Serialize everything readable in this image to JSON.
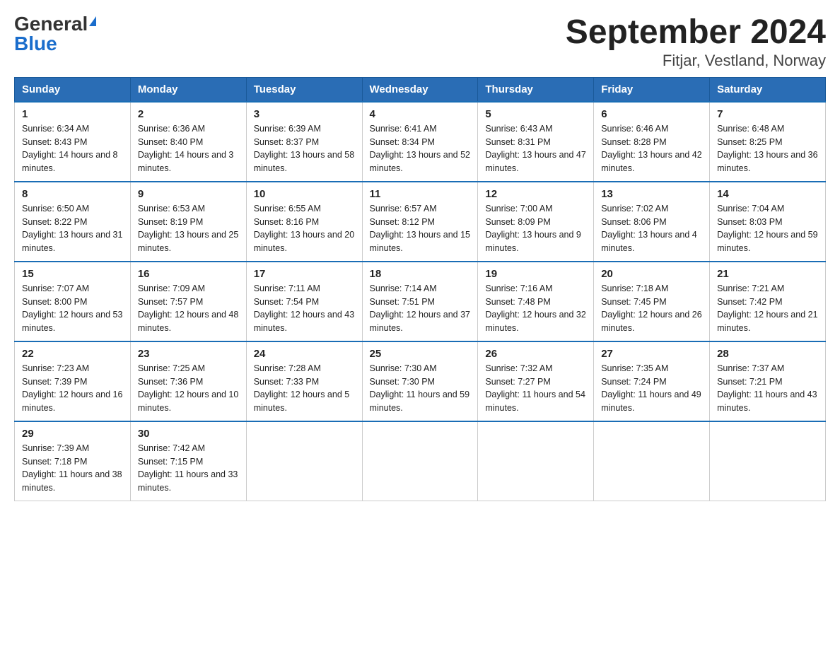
{
  "logo": {
    "general": "General",
    "blue": "Blue"
  },
  "title": "September 2024",
  "subtitle": "Fitjar, Vestland, Norway",
  "weekdays": [
    "Sunday",
    "Monday",
    "Tuesday",
    "Wednesday",
    "Thursday",
    "Friday",
    "Saturday"
  ],
  "weeks": [
    [
      {
        "day": "1",
        "sunrise": "6:34 AM",
        "sunset": "8:43 PM",
        "daylight": "14 hours and 8 minutes."
      },
      {
        "day": "2",
        "sunrise": "6:36 AM",
        "sunset": "8:40 PM",
        "daylight": "14 hours and 3 minutes."
      },
      {
        "day": "3",
        "sunrise": "6:39 AM",
        "sunset": "8:37 PM",
        "daylight": "13 hours and 58 minutes."
      },
      {
        "day": "4",
        "sunrise": "6:41 AM",
        "sunset": "8:34 PM",
        "daylight": "13 hours and 52 minutes."
      },
      {
        "day": "5",
        "sunrise": "6:43 AM",
        "sunset": "8:31 PM",
        "daylight": "13 hours and 47 minutes."
      },
      {
        "day": "6",
        "sunrise": "6:46 AM",
        "sunset": "8:28 PM",
        "daylight": "13 hours and 42 minutes."
      },
      {
        "day": "7",
        "sunrise": "6:48 AM",
        "sunset": "8:25 PM",
        "daylight": "13 hours and 36 minutes."
      }
    ],
    [
      {
        "day": "8",
        "sunrise": "6:50 AM",
        "sunset": "8:22 PM",
        "daylight": "13 hours and 31 minutes."
      },
      {
        "day": "9",
        "sunrise": "6:53 AM",
        "sunset": "8:19 PM",
        "daylight": "13 hours and 25 minutes."
      },
      {
        "day": "10",
        "sunrise": "6:55 AM",
        "sunset": "8:16 PM",
        "daylight": "13 hours and 20 minutes."
      },
      {
        "day": "11",
        "sunrise": "6:57 AM",
        "sunset": "8:12 PM",
        "daylight": "13 hours and 15 minutes."
      },
      {
        "day": "12",
        "sunrise": "7:00 AM",
        "sunset": "8:09 PM",
        "daylight": "13 hours and 9 minutes."
      },
      {
        "day": "13",
        "sunrise": "7:02 AM",
        "sunset": "8:06 PM",
        "daylight": "13 hours and 4 minutes."
      },
      {
        "day": "14",
        "sunrise": "7:04 AM",
        "sunset": "8:03 PM",
        "daylight": "12 hours and 59 minutes."
      }
    ],
    [
      {
        "day": "15",
        "sunrise": "7:07 AM",
        "sunset": "8:00 PM",
        "daylight": "12 hours and 53 minutes."
      },
      {
        "day": "16",
        "sunrise": "7:09 AM",
        "sunset": "7:57 PM",
        "daylight": "12 hours and 48 minutes."
      },
      {
        "day": "17",
        "sunrise": "7:11 AM",
        "sunset": "7:54 PM",
        "daylight": "12 hours and 43 minutes."
      },
      {
        "day": "18",
        "sunrise": "7:14 AM",
        "sunset": "7:51 PM",
        "daylight": "12 hours and 37 minutes."
      },
      {
        "day": "19",
        "sunrise": "7:16 AM",
        "sunset": "7:48 PM",
        "daylight": "12 hours and 32 minutes."
      },
      {
        "day": "20",
        "sunrise": "7:18 AM",
        "sunset": "7:45 PM",
        "daylight": "12 hours and 26 minutes."
      },
      {
        "day": "21",
        "sunrise": "7:21 AM",
        "sunset": "7:42 PM",
        "daylight": "12 hours and 21 minutes."
      }
    ],
    [
      {
        "day": "22",
        "sunrise": "7:23 AM",
        "sunset": "7:39 PM",
        "daylight": "12 hours and 16 minutes."
      },
      {
        "day": "23",
        "sunrise": "7:25 AM",
        "sunset": "7:36 PM",
        "daylight": "12 hours and 10 minutes."
      },
      {
        "day": "24",
        "sunrise": "7:28 AM",
        "sunset": "7:33 PM",
        "daylight": "12 hours and 5 minutes."
      },
      {
        "day": "25",
        "sunrise": "7:30 AM",
        "sunset": "7:30 PM",
        "daylight": "11 hours and 59 minutes."
      },
      {
        "day": "26",
        "sunrise": "7:32 AM",
        "sunset": "7:27 PM",
        "daylight": "11 hours and 54 minutes."
      },
      {
        "day": "27",
        "sunrise": "7:35 AM",
        "sunset": "7:24 PM",
        "daylight": "11 hours and 49 minutes."
      },
      {
        "day": "28",
        "sunrise": "7:37 AM",
        "sunset": "7:21 PM",
        "daylight": "11 hours and 43 minutes."
      }
    ],
    [
      {
        "day": "29",
        "sunrise": "7:39 AM",
        "sunset": "7:18 PM",
        "daylight": "11 hours and 38 minutes."
      },
      {
        "day": "30",
        "sunrise": "7:42 AM",
        "sunset": "7:15 PM",
        "daylight": "11 hours and 33 minutes."
      },
      null,
      null,
      null,
      null,
      null
    ]
  ]
}
